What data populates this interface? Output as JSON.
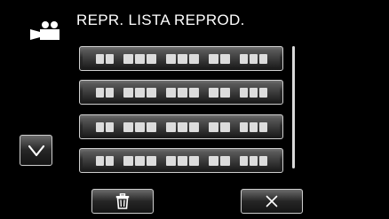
{
  "header": {
    "title": "REPR. LISTA REPROD.",
    "icon": "video-camera-icon"
  },
  "list": {
    "items": [
      {
        "placeholder_label": "playlist-entry"
      },
      {
        "placeholder_label": "playlist-entry"
      },
      {
        "placeholder_label": "playlist-entry"
      },
      {
        "placeholder_label": "playlist-entry"
      }
    ]
  },
  "controls": {
    "scroll_down_icon": "chevron-down-icon",
    "delete_icon": "trash-icon",
    "close_icon": "close-icon"
  },
  "colors": {
    "background": "#000000",
    "text": "#ffffff",
    "button_border": "#cfcfcf"
  }
}
